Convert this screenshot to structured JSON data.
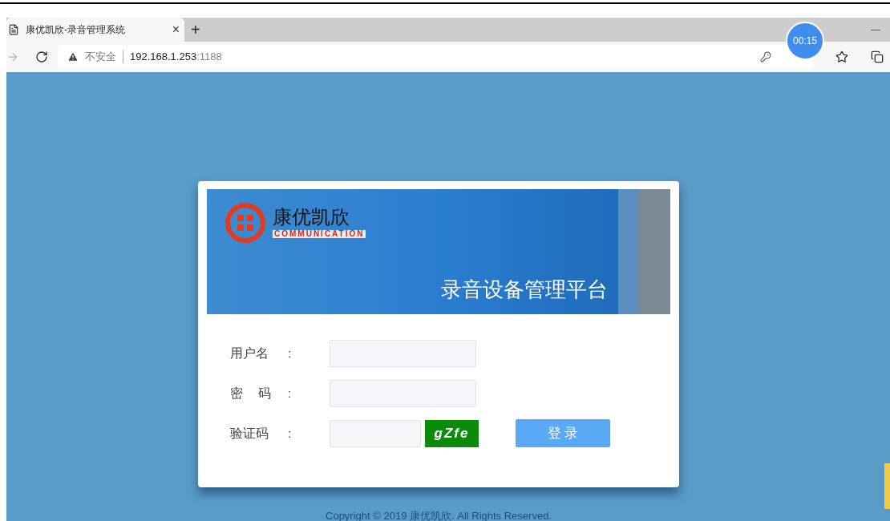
{
  "browser": {
    "tab": {
      "title": "康优凯欣-录音管理系统",
      "close": "×"
    },
    "new_tab": "+",
    "minimize": "—",
    "address": {
      "security": "不安全",
      "host": "192.168.1.253",
      "port": ":1188"
    },
    "timer": "00:15"
  },
  "banner": {
    "brand": "康优凯欣",
    "brand_sub": "COMMUNICATION",
    "title": "录音设备管理平台"
  },
  "form": {
    "fields": [
      {
        "kind": "text",
        "label": "用户名",
        "colon": ":"
      },
      {
        "kind": "password",
        "label": "密 码",
        "colon": ":"
      },
      {
        "kind": "captcha",
        "label": "验证码",
        "colon": ":",
        "captcha": "gZfe"
      }
    ],
    "submit": "登 录"
  },
  "footer": "Copyright © 2019 康优凯欣. All Rights Reserved."
}
